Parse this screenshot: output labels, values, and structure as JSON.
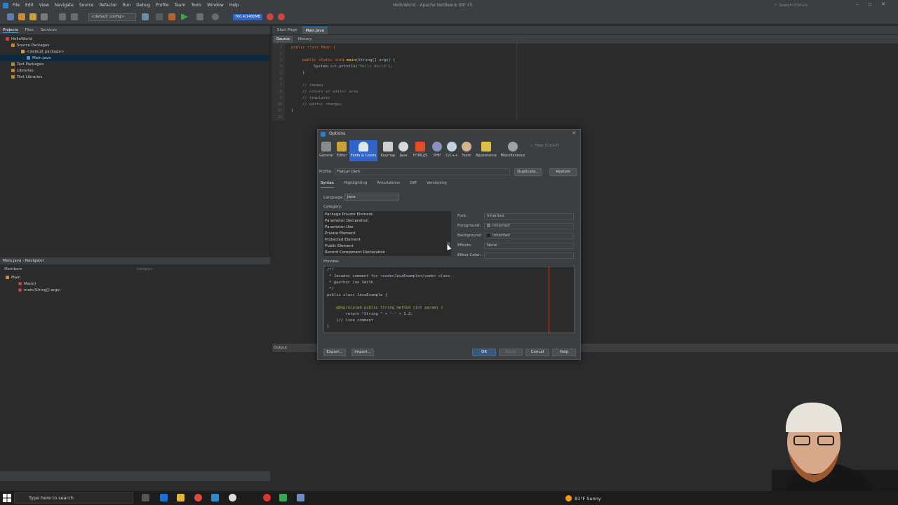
{
  "window": {
    "title": "HelloWorld - Apache NetBeans IDE 15",
    "search_placeholder": "Search (Ctrl+I)"
  },
  "menu": [
    "File",
    "Edit",
    "View",
    "Navigate",
    "Source",
    "Refactor",
    "Run",
    "Debug",
    "Profile",
    "Team",
    "Tools",
    "Window",
    "Help"
  ],
  "toolbar": {
    "config": "<default config>",
    "memory": "700.4/1480MB"
  },
  "projects_panel": {
    "tabs": [
      "Projects",
      "Files",
      "Services"
    ],
    "tree": [
      {
        "label": "HelloWorld",
        "level": 0
      },
      {
        "label": "Source Packages",
        "level": 1
      },
      {
        "label": "<default package>",
        "level": 2
      },
      {
        "label": "Main.java",
        "level": 3,
        "selected": true
      },
      {
        "label": "Test Packages",
        "level": 1
      },
      {
        "label": "Libraries",
        "level": 1
      },
      {
        "label": "Test Libraries",
        "level": 1
      }
    ]
  },
  "navigator": {
    "title": "Main.java - Navigator",
    "members_label": "Members",
    "filter": "<empty>",
    "tree": [
      {
        "label": "Main",
        "level": 0
      },
      {
        "label": "Main()",
        "level": 1
      },
      {
        "label": "main(String[] args)",
        "level": 1
      }
    ]
  },
  "editor": {
    "tabs": [
      "Start Page",
      "Main.java"
    ],
    "subtabs": [
      "Source",
      "History"
    ],
    "line_numbers": [
      "1",
      "2",
      "3",
      "4",
      "5",
      "6",
      "7",
      "8",
      "9",
      "10",
      "11",
      "12"
    ],
    "code": {
      "l1": "public class Main {",
      "l3_a": "public static void ",
      "l3_fn": "main",
      "l3_b": "(String[] args) {",
      "l4_a": "System.",
      "l4_b": "out",
      "l4_c": ".println(",
      "l4_str": "\"Hello World\"",
      "l4_d": ");",
      "l5": "}",
      "l7": "// themes",
      "l8": "// colors of editor area",
      "l9": "// templates",
      "l10": "// editor changes",
      "l11": "}"
    }
  },
  "output": {
    "tab": "Output"
  },
  "dialog": {
    "title": "Options",
    "categories": [
      "General",
      "Editor",
      "Fonts & Colors",
      "Keymap",
      "Java",
      "HTML/JS",
      "PHP",
      "C/C++",
      "Team",
      "Appearance",
      "Miscellaneous"
    ],
    "filter_placeholder": "Filter (Ctrl+F)",
    "profile_label": "Profile:",
    "profile_value": "FlatLaf Dark",
    "duplicate_btn": "Duplicate...",
    "restore_btn": "Restore",
    "subtabs": [
      "Syntax",
      "Highlighting",
      "Annotations",
      "Diff",
      "Versioning"
    ],
    "language_label": "Language:",
    "language_value": "Java",
    "category_label": "Category:",
    "category_items": [
      "Package Private Element",
      "Parameter Declaration",
      "Parameter Use",
      "Private Element",
      "Protected Element",
      "Public Element",
      "Record Component Declaration"
    ],
    "font_label": "Font:",
    "font_value": "Inherited",
    "foreground_label": "Foreground:",
    "foreground_value": "Inherited",
    "background_label": "Background:",
    "background_value": "Inherited",
    "effects_label": "Effects:",
    "effects_value": "None",
    "effect_color_label": "Effect Color:",
    "preview_label": "Preview:",
    "preview": {
      "p1": "/**",
      "p2": " * Javadoc comment for <code>JavaExample</code> class.",
      "p3": " * @author Joe Smith",
      "p4": " */",
      "p5": "public class JavaExample {",
      "p6": "    @Deprecated public String method (int param) {",
      "p7": "        return \"String \" + '-' + 1.2;",
      "p8": "    }// line comment",
      "p9": "}"
    },
    "buttons": {
      "export": "Export...",
      "import": "Import...",
      "ok": "OK",
      "apply": "Apply",
      "cancel": "Cancel",
      "help": "Help"
    }
  },
  "taskbar": {
    "search_placeholder": "Type here to search",
    "weather": "81°F Sunny"
  }
}
